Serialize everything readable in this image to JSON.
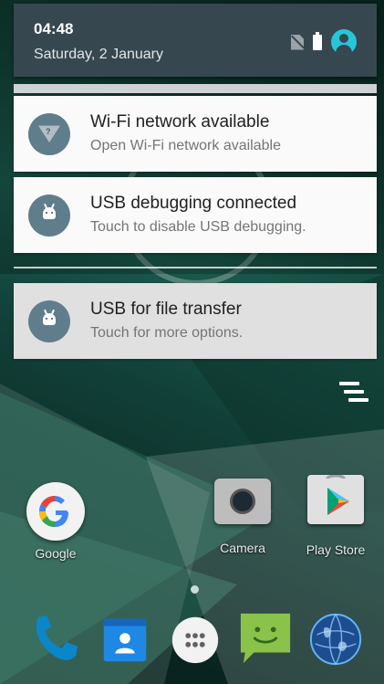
{
  "status": {
    "time": "04:48",
    "date": "Saturday, 2 January"
  },
  "notifications": [
    {
      "icon": "wifi-icon",
      "title": "Wi-Fi network available",
      "text": "Open Wi-Fi network available"
    },
    {
      "icon": "android-icon",
      "title": "USB debugging connected",
      "text": "Touch to disable USB debugging."
    },
    {
      "icon": "android-icon",
      "title": "USB for file transfer",
      "text": "Touch for more options."
    }
  ],
  "home": {
    "apps": [
      {
        "label": "Google",
        "icon": "google-icon"
      },
      {
        "label": "Camera",
        "icon": "camera-icon"
      },
      {
        "label": "Play Store",
        "icon": "play-store-icon"
      }
    ],
    "dock": [
      "phone-icon",
      "contacts-icon",
      "app-drawer-icon",
      "messaging-icon",
      "browser-icon"
    ]
  },
  "colors": {
    "header": "#37474f",
    "accent": "#26c6da",
    "notification_icon": "#607d8b"
  }
}
